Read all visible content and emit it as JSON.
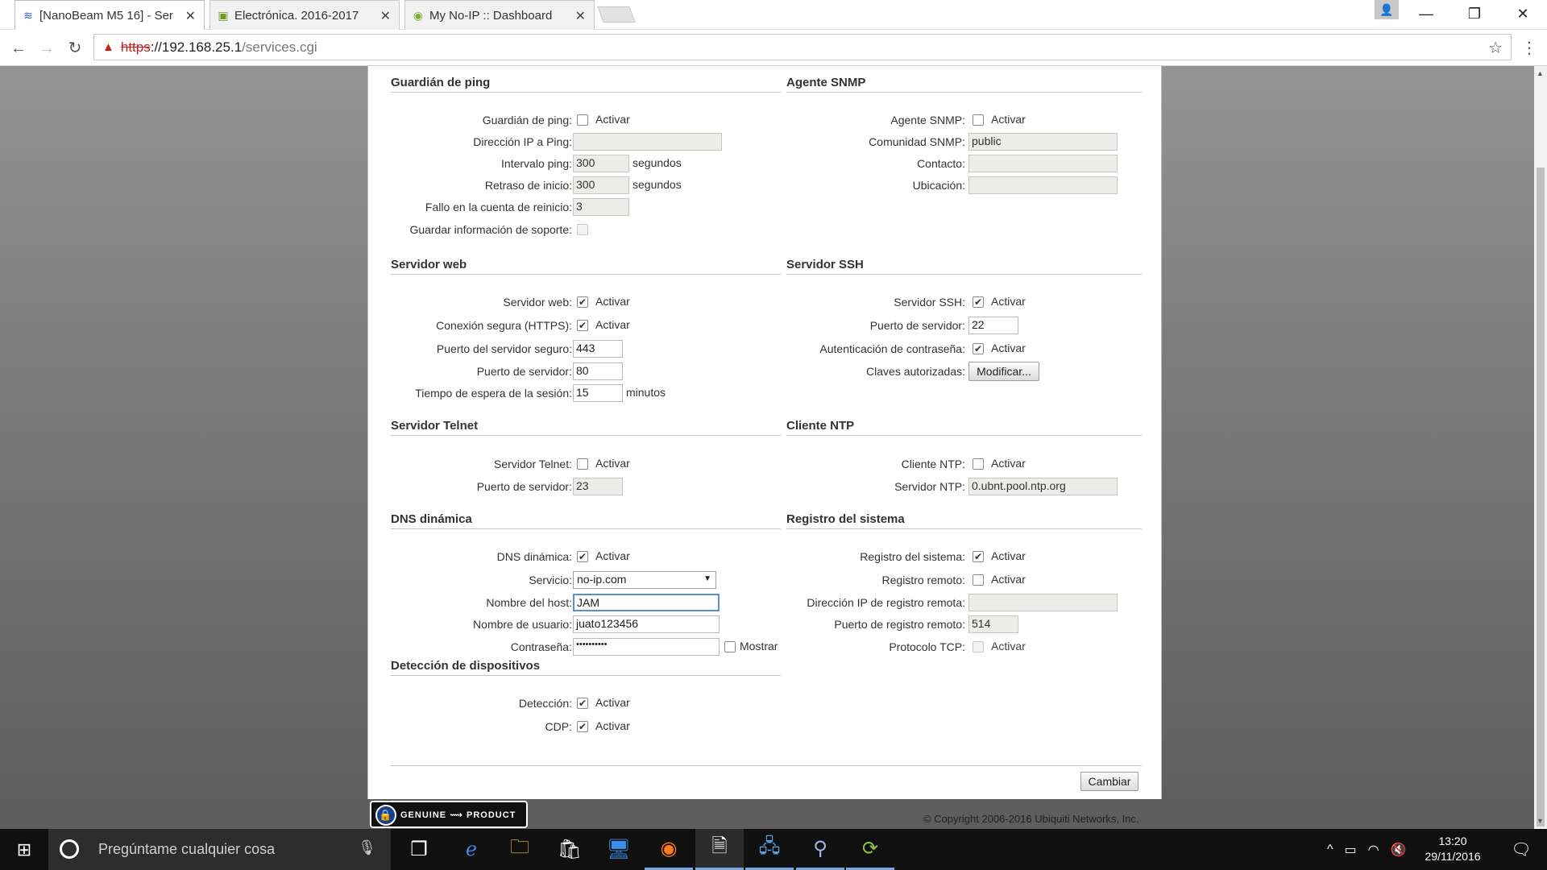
{
  "browser": {
    "tabs": [
      {
        "title": "[NanoBeam M5 16] - Ser",
        "favicon": "wifi-icon"
      },
      {
        "title": "Electrónica. 2016-2017",
        "favicon": "moodle-icon"
      },
      {
        "title": "My No-IP :: Dashboard",
        "favicon": "noip-icon"
      }
    ],
    "url": {
      "scheme": "https",
      "rest": "://192.168.25.1",
      "path": "/services.cgi"
    }
  },
  "ping": {
    "title": "Guardián de ping",
    "watchdog_label": "Guardián de ping:",
    "watchdog_check": "Activar",
    "ip_label": "Dirección IP a Ping:",
    "ip_value": "",
    "interval_label": "Intervalo ping:",
    "interval_value": "300",
    "interval_unit": "segundos",
    "delay_label": "Retraso de inicio:",
    "delay_value": "300",
    "delay_unit": "segundos",
    "fail_label": "Fallo en la cuenta de reinicio:",
    "fail_value": "3",
    "support_label": "Guardar información de soporte:"
  },
  "snmp": {
    "title": "Agente SNMP",
    "agent_label": "Agente SNMP:",
    "agent_check": "Activar",
    "community_label": "Comunidad SNMP:",
    "community_value": "public",
    "contact_label": "Contacto:",
    "contact_value": "",
    "location_label": "Ubicación:",
    "location_value": ""
  },
  "web": {
    "title": "Servidor web",
    "server_label": "Servidor web:",
    "server_check": "Activar",
    "https_label": "Conexión segura (HTTPS):",
    "https_check": "Activar",
    "secure_port_label": "Puerto del servidor seguro:",
    "secure_port_value": "443",
    "port_label": "Puerto de servidor:",
    "port_value": "80",
    "timeout_label": "Tiempo de espera de la sesión:",
    "timeout_value": "15",
    "timeout_unit": "minutos"
  },
  "ssh": {
    "title": "Servidor SSH",
    "server_label": "Servidor SSH:",
    "server_check": "Activar",
    "port_label": "Puerto de servidor:",
    "port_value": "22",
    "auth_label": "Autenticación de contraseña:",
    "auth_check": "Activar",
    "keys_label": "Claves autorizadas:",
    "keys_button": "Modificar..."
  },
  "telnet": {
    "title": "Servidor Telnet",
    "server_label": "Servidor Telnet:",
    "server_check": "Activar",
    "port_label": "Puerto de servidor:",
    "port_value": "23"
  },
  "ntp": {
    "title": "Cliente NTP",
    "client_label": "Cliente NTP:",
    "client_check": "Activar",
    "server_label": "Servidor NTP:",
    "server_value": "0.ubnt.pool.ntp.org"
  },
  "ddns": {
    "title": "DNS dinámica",
    "enable_label": "DNS dinámica:",
    "enable_check": "Activar",
    "service_label": "Servicio:",
    "service_value": "no-ip.com",
    "host_label": "Nombre del host:",
    "host_value": "JAM",
    "user_label": "Nombre de usuario:",
    "user_value": "juato123456",
    "pass_label": "Contraseña:",
    "pass_value": "••••••••••",
    "show_check": "Mostrar"
  },
  "syslog": {
    "title": "Registro del sistema",
    "enable_label": "Registro del sistema:",
    "enable_check": "Activar",
    "remote_label": "Registro remoto:",
    "remote_check": "Activar",
    "remote_ip_label": "Dirección IP de registro remota:",
    "remote_ip_value": "",
    "remote_port_label": "Puerto de registro remoto:",
    "remote_port_value": "514",
    "tcp_label": "Protocolo TCP:",
    "tcp_check": "Activar"
  },
  "discovery": {
    "title": "Detección de dispositivos",
    "detect_label": "Detección:",
    "detect_check": "Activar",
    "cdp_label": "CDP:",
    "cdp_check": "Activar"
  },
  "footer": {
    "apply_button": "Cambiar",
    "genuine_text": "GENUINE ⟿ PRODUCT",
    "copyright": "© Copyright 2006-2016 Ubiquiti Networks, Inc."
  },
  "taskbar": {
    "search_placeholder": "Pregúntame cualquier cosa",
    "time": "13:20",
    "date": "29/11/2016"
  }
}
